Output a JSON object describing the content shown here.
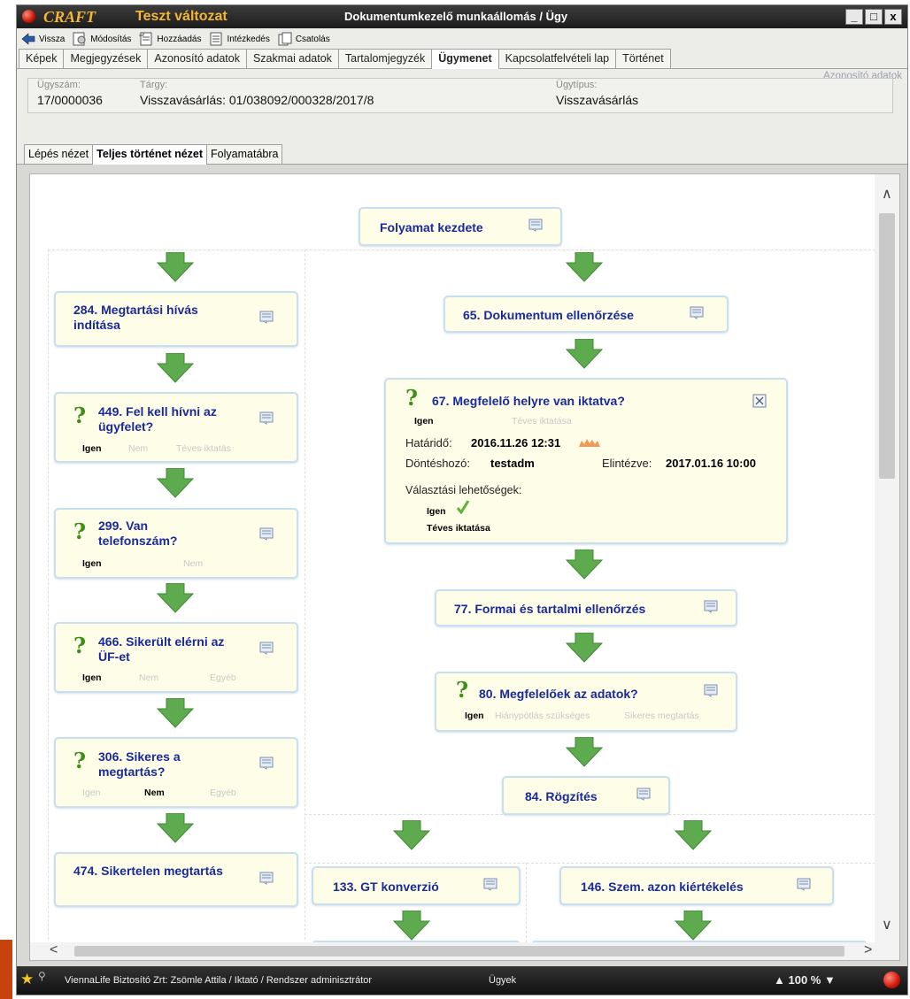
{
  "window": {
    "brand": "CRAFT",
    "variant": "Teszt változat",
    "title": "Dokumentumkezelő munkaállomás / Ügy",
    "buttons": {
      "minimize": "_",
      "maximize": "□",
      "close": "x"
    }
  },
  "toolbar": {
    "back": "Vissza",
    "modify": "Módosítás",
    "add": "Hozzáadás",
    "action": "Intézkedés",
    "attach": "Csatolás"
  },
  "tabs": [
    "Képek",
    "Megjegyzések",
    "Azonosító adatok",
    "Szakmai adatok",
    "Tartalomjegyzék",
    "Ügymenet",
    "Kapcsolatfelvételi lap",
    "Történet"
  ],
  "active_tab": "Ügymenet",
  "id_panel": {
    "legend": "Azonosító adatok",
    "case_no_label": "Ügyszám:",
    "case_no": "17/0000036",
    "subject_label": "Tárgy:",
    "subject": "Visszavásárlás: 01/038092/000328/2017/8",
    "type_label": "Ügytípus:",
    "type": "Visszavásárlás"
  },
  "subtabs": [
    "Lépés nézet",
    "Teljes történet nézet",
    "Folyamatábra"
  ],
  "active_subtab": "Teljes történet nézet",
  "flow": {
    "start": "Folyamat kezdete",
    "n284": "284. Megtartási hívás indítása",
    "n449": "449. Fel kell hívni az ügyfelet?",
    "n449_opts": [
      "Igen",
      "Nem",
      "Téves iktatás"
    ],
    "n299": "299. Van telefonszám?",
    "n299_opts": [
      "Igen",
      "Nem"
    ],
    "n466": "466. Sikerült elérni az ÜF-et",
    "n466_opts": [
      "Igen",
      "Nem",
      "Egyéb"
    ],
    "n306": "306. Sikeres a megtartás?",
    "n306_opts": [
      "Igen",
      "Nem",
      "Egyéb"
    ],
    "n474": "474. Sikertelen megtartás",
    "n65": "65. Dokumentum ellenőrzése",
    "n67": {
      "title": "67. Megfelelő helyre van iktatva?",
      "opts": [
        "Igen",
        "Téves iktatása"
      ],
      "deadline_label": "Határidő:",
      "deadline": "2016.11.26 12:31",
      "decider_label": "Döntéshozó:",
      "decider": "testadm",
      "done_label": "Elintézve:",
      "done": "2017.01.16 10:00",
      "choices_label": "Választási lehetőségek:",
      "choices": [
        "Igen",
        "Téves iktatása"
      ]
    },
    "n77": "77. Formai és tartalmi ellenőrzés",
    "n80": "80. Megfelelőek az adatok?",
    "n80_opts": [
      "Igen",
      "Hiánypótlás szükséges",
      "Sikeres megtartás"
    ],
    "n84": "84. Rögzítés",
    "n133": "133. GT konverzió",
    "n146": "146. Szem. azon kiértékelés"
  },
  "status": {
    "user": "ViennaLife Biztosító Zrt: Zsömle Attila / Iktató / Rendszer adminisztrátor",
    "cases": "Ügyek",
    "zoom": "▲ 100 % ▼"
  }
}
